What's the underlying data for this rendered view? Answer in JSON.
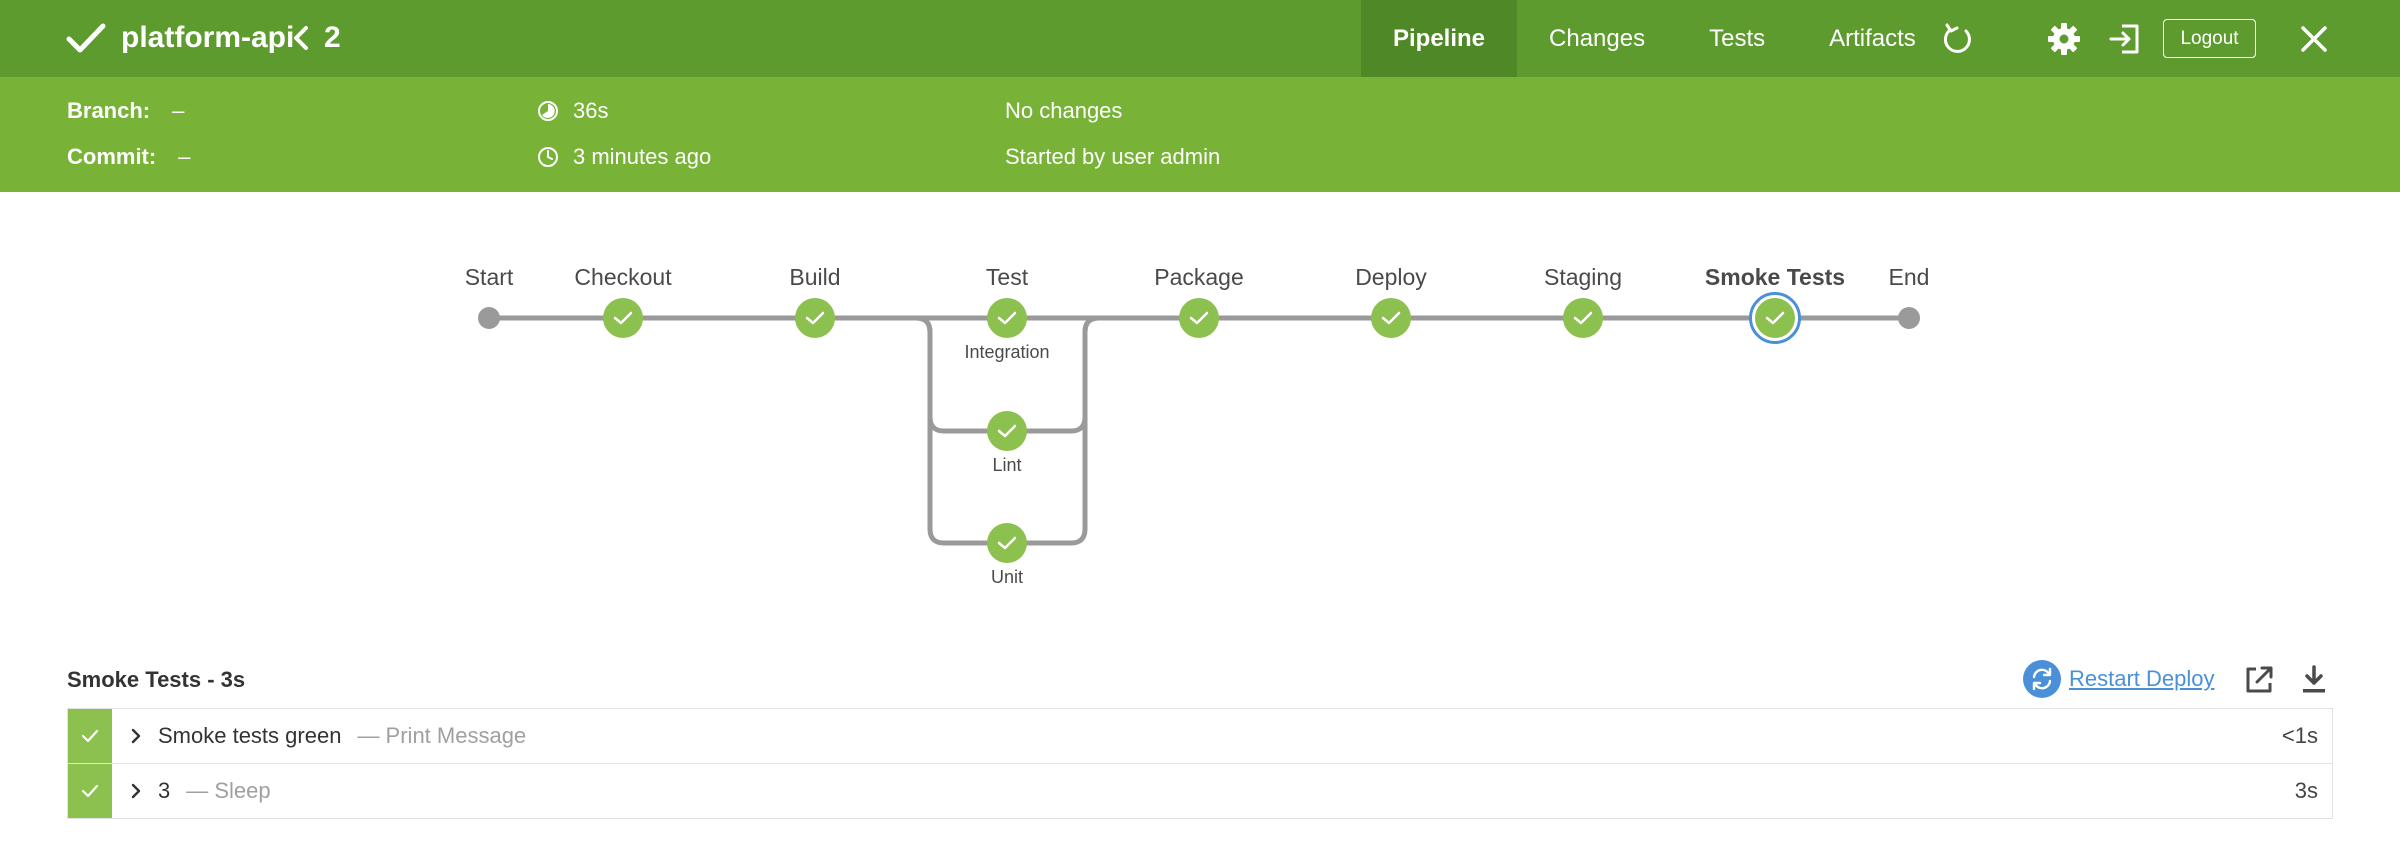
{
  "header": {
    "pipeline_name": "platform-api",
    "run_number": "2",
    "tabs": [
      {
        "label": "Pipeline",
        "active": true
      },
      {
        "label": "Changes",
        "active": false
      },
      {
        "label": "Tests",
        "active": false
      },
      {
        "label": "Artifacts",
        "active": false
      }
    ],
    "logout_label": "Logout",
    "bar_color": "#5e9b2f",
    "icons": [
      "check-icon",
      "chevron-left-icon",
      "replay-icon",
      "gear-icon",
      "exit-icon",
      "close-icon"
    ]
  },
  "info": {
    "branch_label": "Branch:",
    "branch_value": "–",
    "commit_label": "Commit:",
    "commit_value": "–",
    "duration": "36s",
    "started_ago": "3 minutes ago",
    "changes": "No changes",
    "started_by": "Started by user admin",
    "bar_color": "#78b237"
  },
  "graph": {
    "stages": [
      "Start",
      "Checkout",
      "Build",
      "Test",
      "Package",
      "Deploy",
      "Staging",
      "Smoke Tests",
      "End"
    ],
    "selected_stage": "Smoke Tests",
    "parallel_branches": [
      "Integration",
      "Lint",
      "Unit"
    ],
    "success_color": "#8cc04f",
    "selected_ring_color": "#4a90d9"
  },
  "steps_panel": {
    "title": "Smoke Tests - 3s",
    "restart_label": "Restart Deploy",
    "steps": [
      {
        "name": "Smoke tests green",
        "type": "— Print Message",
        "duration": "<1s"
      },
      {
        "name": "3",
        "type": "— Sleep",
        "duration": "3s"
      }
    ]
  }
}
